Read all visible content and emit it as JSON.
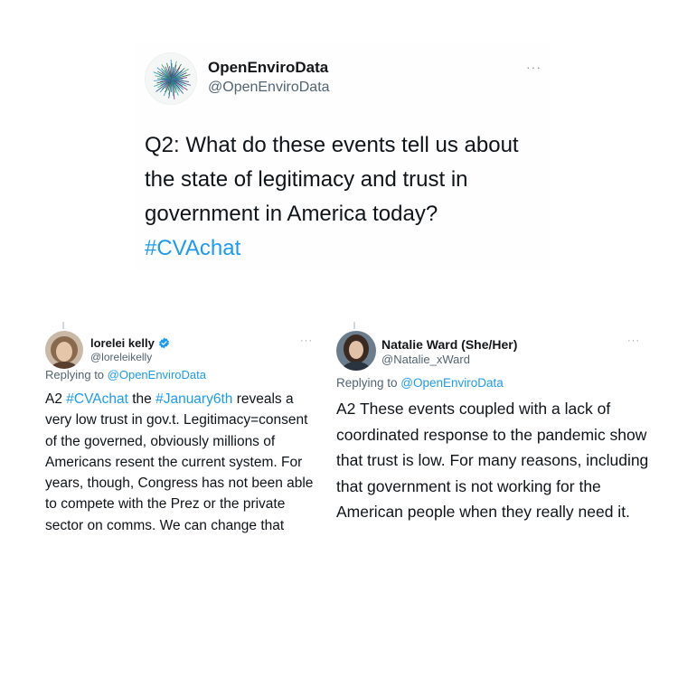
{
  "main_tweet": {
    "name": "OpenEnviroData",
    "handle": "@OpenEnviroData",
    "more": "···",
    "text": "Q2: What do these events tell us about the state of legitimacy and trust in government in America today?",
    "hashtag": "#CVAchat"
  },
  "replies": [
    {
      "name": "lorelei kelly",
      "handle": "@loreleikelly",
      "verified": true,
      "more": "···",
      "replying_prefix": "Replying to ",
      "replying_to": "@OpenEnviroData",
      "text_parts": [
        {
          "text": "A2 ",
          "type": "plain"
        },
        {
          "text": "#CVAchat",
          "type": "hashtag"
        },
        {
          "text": " the ",
          "type": "plain"
        },
        {
          "text": "#January6th",
          "type": "hashtag"
        },
        {
          "text": " reveals a very low trust in gov.t. Legitimacy=consent of the governed, obviously millions of Americans resent the current system. For years, though, Congress has not been able to compete with the Prez or the private sector on comms. We can change that",
          "type": "plain"
        }
      ]
    },
    {
      "name": "Natalie Ward (She/Her)",
      "handle": "@Natalie_xWard",
      "verified": false,
      "more": "···",
      "replying_prefix": "Replying to ",
      "replying_to": "@OpenEnviroData",
      "text": "A2 These events coupled with a lack of coordinated response to the pandemic show that trust is low. For many reasons, including that government is not working for the American people when they really need it."
    }
  ],
  "colors": {
    "link": "#1d9bf0",
    "text": "#0f1419",
    "secondary": "#536471",
    "verified": "#1d9bf0"
  },
  "icons": {
    "main_avatar": "starburst-logo-icon",
    "verified": "verified-badge-icon",
    "more": "more-options-icon"
  }
}
